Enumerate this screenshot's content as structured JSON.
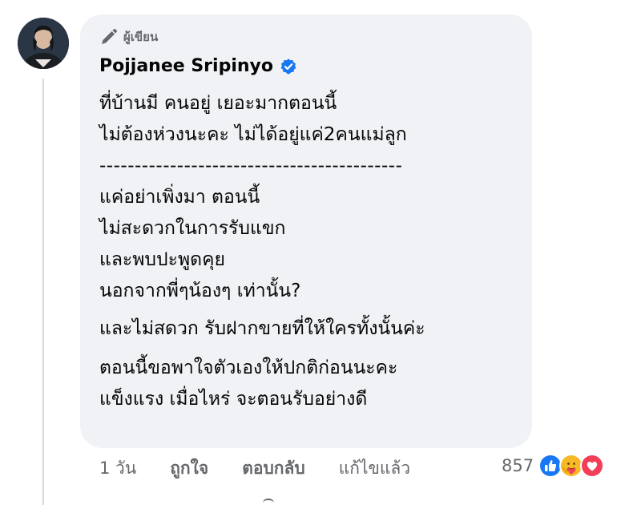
{
  "comment": {
    "author_badge_label": "ผู้เขียน",
    "author_name": "Pojjanee Sripinyo",
    "lines": [
      "ที่บ้านมี คนอยู่ เยอะมากตอนนี้",
      "ไม่ต้องห่วงนะคะ ไม่ได้อยู่แค่2คนแม่ลูก",
      "-------------------------------------------",
      "แค่อย่าเพิ่งมา ตอนนี้",
      "ไม่สะดวกในการรับแขก",
      "และพบปะพูดคุย",
      "นอกจากพี่ๆน้องๆ เท่านั้น?",
      "และไม่สดวก รับฝากขายที่ให้ใครทั้งนั้นค่ะ",
      "ตอนนี้ขอพาใจตัวเองให้ปกติก่อนนะคะ",
      "แข็งแรง เมื่อไหร่ จะตอนรับอย่างดี"
    ]
  },
  "actions": {
    "time": "1 วัน",
    "like": "ถูกใจ",
    "reply": "ตอบกลับ",
    "edited": "แก้ไขแล้ว"
  },
  "reactions": {
    "count": "857",
    "icons": [
      "like-icon",
      "care-icon",
      "love-icon"
    ],
    "colors": {
      "like": "#1877f2",
      "care": "#f7b928",
      "love": "#f33e58"
    }
  },
  "colors": {
    "bubble": "#f0f2f5",
    "verified": "#1877f2",
    "secondary_text": "#65676b"
  }
}
